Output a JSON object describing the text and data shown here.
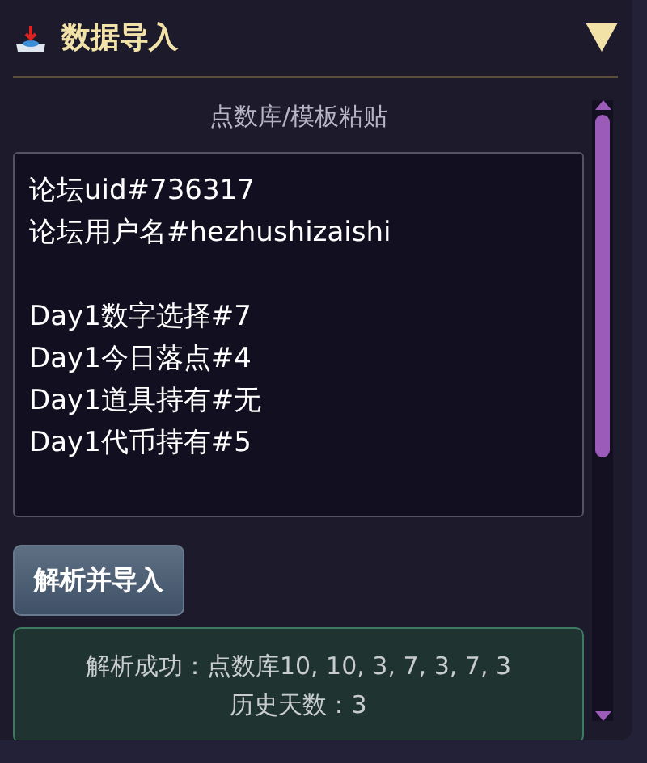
{
  "panel": {
    "title": "数据导入",
    "expanded": true
  },
  "subtitle": "点数库/模板粘贴",
  "paste_field": {
    "value": "论坛uid#736317\n论坛用户名#hezhushizaishi\n\nDay1数字选择#7\nDay1今日落点#4\nDay1道具持有#无\nDay1代币持有#5"
  },
  "button": "解析并导入",
  "status": {
    "kind": "success",
    "lines": [
      "解析成功：点数库10, 10, 3, 7, 3, 7, 3",
      "历史天数：3"
    ]
  }
}
